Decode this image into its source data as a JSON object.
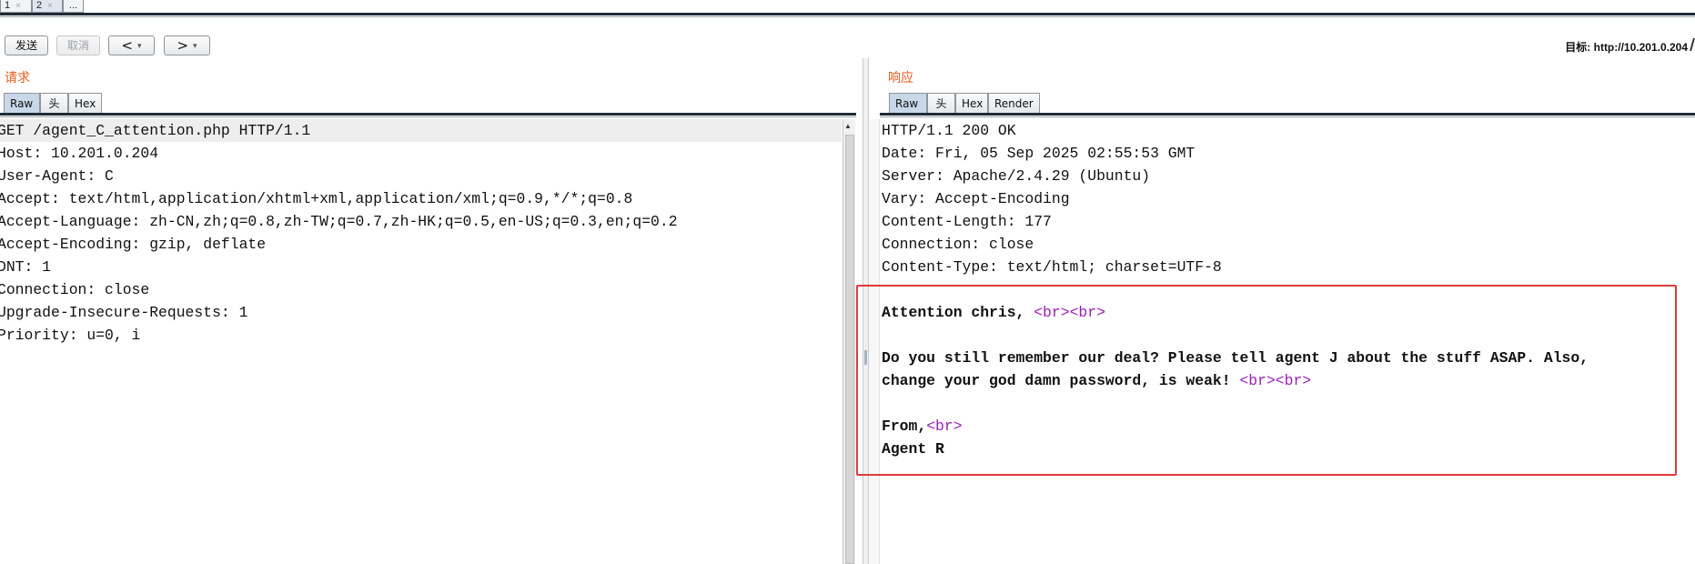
{
  "tabs": [
    {
      "label": "1",
      "close": "×"
    },
    {
      "label": "2",
      "close": "×"
    },
    {
      "label": "...",
      "close": ""
    }
  ],
  "toolbar": {
    "send_label": "发送",
    "cancel_label": "取消",
    "back_label": "<",
    "forward_label": ">",
    "dropdown_glyph": "▾",
    "target_text": "目标: http://10.201.0.204"
  },
  "request": {
    "title": "请求",
    "tabs": [
      "Raw",
      "头",
      "Hex"
    ],
    "active_tab": "Raw",
    "lines": [
      "GET /agent_C_attention.php HTTP/1.1",
      "Host: 10.201.0.204",
      "User-Agent: C",
      "Accept: text/html,application/xhtml+xml,application/xml;q=0.9,*/*;q=0.8",
      "Accept-Language: zh-CN,zh;q=0.8,zh-TW;q=0.7,zh-HK;q=0.5,en-US;q=0.3,en;q=0.2",
      "Accept-Encoding: gzip, deflate",
      "DNT: 1",
      "Connection: close",
      "Upgrade-Insecure-Requests: 1",
      "Priority: u=0, i"
    ]
  },
  "response": {
    "title": "响应",
    "tabs": [
      "Raw",
      "头",
      "Hex",
      "Render"
    ],
    "active_tab": "Raw",
    "header_lines": [
      "HTTP/1.1 200 OK",
      "Date: Fri, 05 Sep 2025 02:55:53 GMT",
      "Server: Apache/2.4.29 (Ubuntu)",
      "Vary: Accept-Encoding",
      "Content-Length: 177",
      "Connection: close",
      "Content-Type: text/html; charset=UTF-8"
    ],
    "body": {
      "line1_text": "Attention chris, ",
      "line1_tags": "<br><br>",
      "line2_text": "Do you still remember our deal? Please tell agent J about the stuff ASAP. Also,",
      "line3_text": "change your god damn password, is weak! ",
      "line3_tags": "<br><br>",
      "line4_text": "From,",
      "line4_tags": "<br>",
      "line5_text": "Agent R"
    }
  },
  "colors": {
    "accent_title": "#e8591a",
    "tag_color": "#9a1fb5",
    "highlight_border": "#e03a3a",
    "tab_underline": "#1f2b36"
  }
}
